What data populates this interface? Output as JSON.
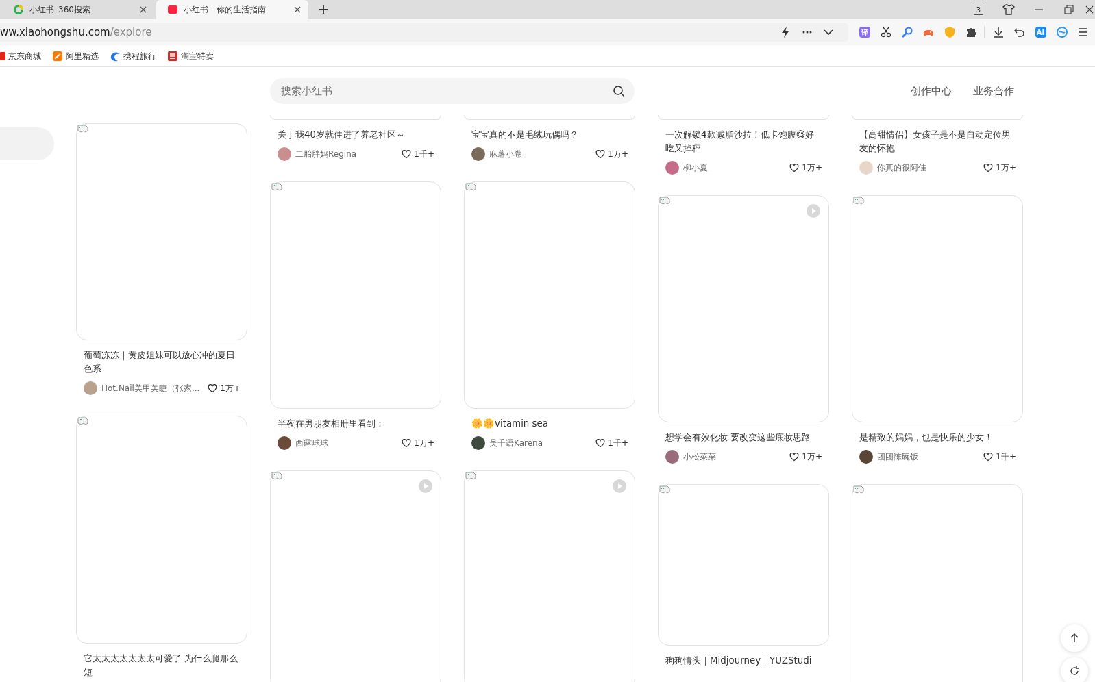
{
  "browser": {
    "tabs": [
      {
        "title": "小红书_360搜索",
        "selected": false
      },
      {
        "title": "小红书 - 你的生活指南",
        "selected": true
      }
    ],
    "tab_count": "3",
    "address": {
      "host": "ww.xiaohongshu.com",
      "path": "/explore"
    },
    "translate_badge": "译",
    "ai_badge": "AI",
    "bookmarks": [
      "京东商城",
      "阿里精选",
      "携程旅行",
      "淘宝特卖"
    ]
  },
  "header": {
    "search": {
      "placeholder": "搜索小红书"
    },
    "links": [
      "创作中心",
      "业务合作"
    ]
  },
  "feed": {
    "columns": [
      [
        {
          "title": "葡萄冻冻｜黄皮姐妹可以放心冲的夏日色系",
          "author": "Hot.Nail美甲美睫（张家...",
          "likes": "1万+",
          "video": false
        },
        {
          "title": "它太太太太太太太可爱了 为什么腿那么短",
          "video": false
        }
      ],
      [
        {
          "title": "关于我40岁就住进了养老社区～",
          "author": "二胎胖妈Regina",
          "likes": "1千+"
        },
        {
          "title": "半夜在男朋友相册里看到：",
          "author": "西露球球",
          "likes": "1万+",
          "video": false
        },
        {
          "video": true
        }
      ],
      [
        {
          "title": "宝宝真的不是毛绒玩偶吗？",
          "author": "麻薯小卷",
          "likes": "1万+"
        },
        {
          "title": "🌼🌼vitamin sea",
          "author": "吴千语Karena",
          "likes": "1千+",
          "video": false
        },
        {
          "video": true
        }
      ],
      [
        {
          "title": "一次解锁4款减脂沙拉！低卡饱腹😋好吃又掉秤",
          "author": "柳小夏",
          "likes": "1万+"
        },
        {
          "title": "想学会有效化妆 要改变这些底妆思路",
          "author": "小松菜菜",
          "likes": "1万+",
          "video": true
        },
        {
          "title": "狗狗情头｜Midjourney｜YUZStudi",
          "video": false
        }
      ],
      [
        {
          "title": "【高甜情侣】女孩子是不是自动定位男友的怀抱",
          "author": "你真的很阿佳",
          "likes": "1万+"
        },
        {
          "title": "是精致的妈妈，也是快乐的少女！",
          "author": "团团陈碗饭",
          "likes": "1千+",
          "video": false
        },
        {
          "video": false
        }
      ]
    ]
  }
}
